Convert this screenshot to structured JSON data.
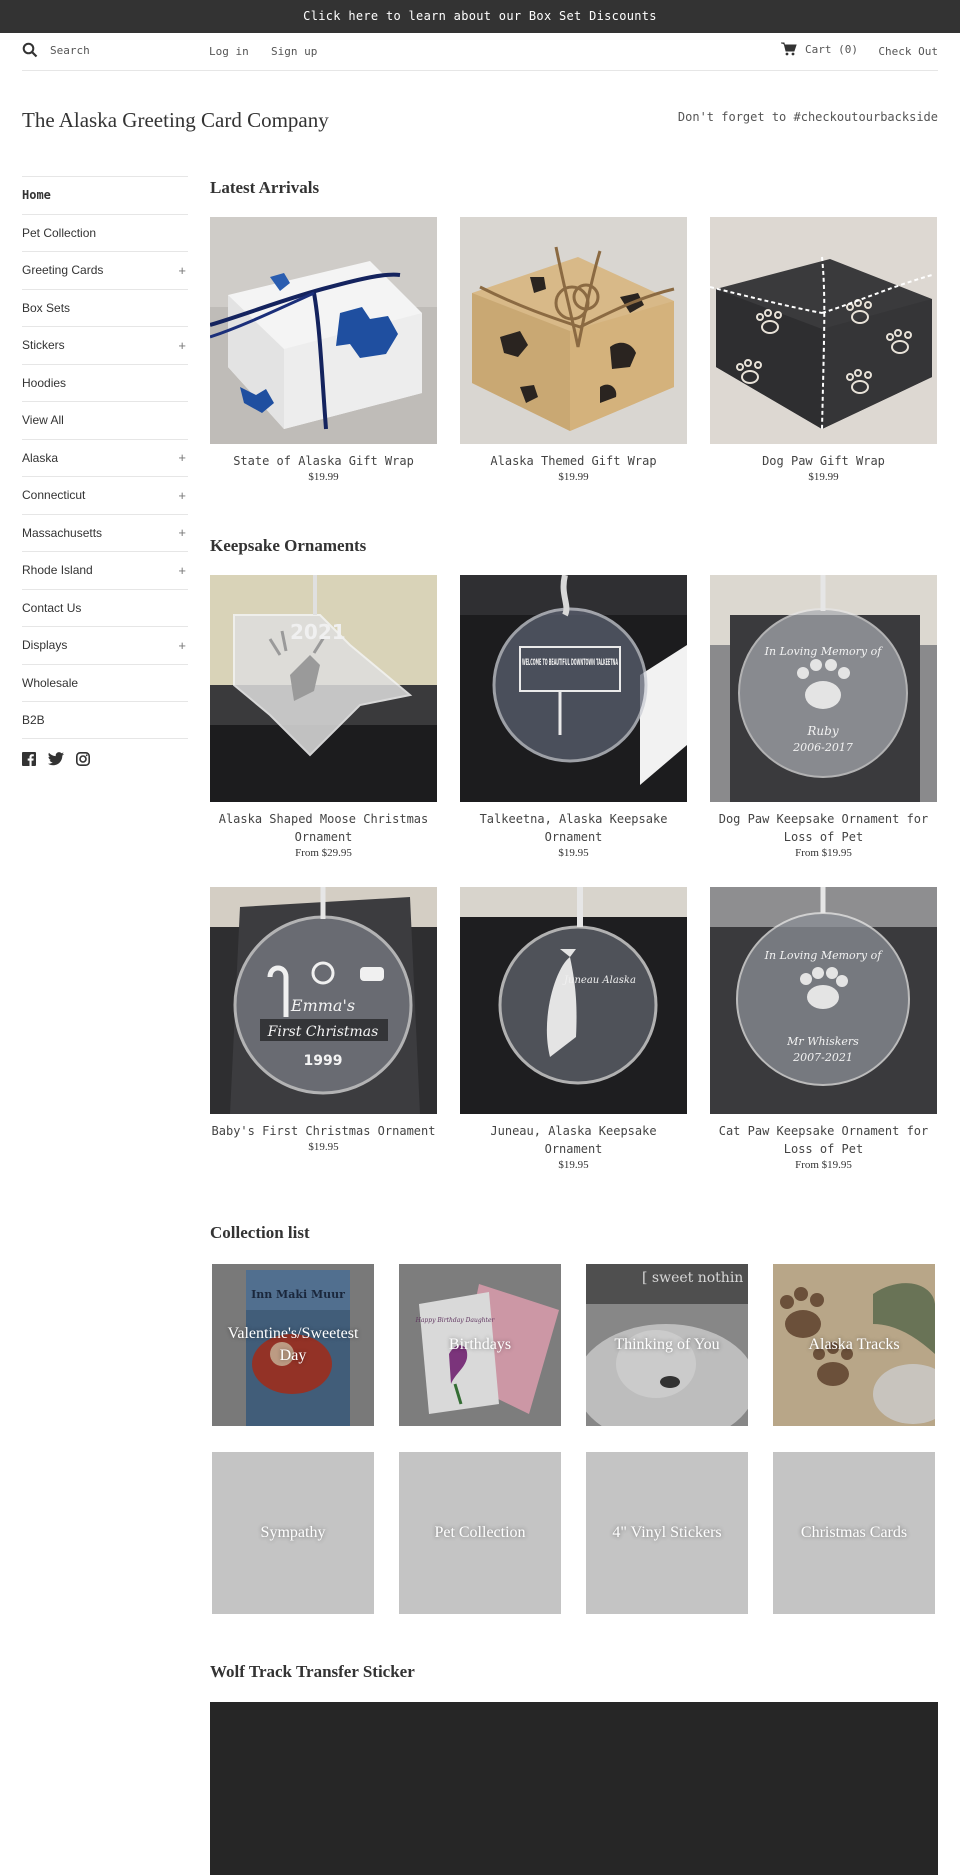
{
  "announcement": "Click here to learn about our Box Set Discounts",
  "header": {
    "search_placeholder": "Search",
    "login": "Log in",
    "signup": "Sign up",
    "cart": "Cart (0)",
    "checkout": "Check Out"
  },
  "brand": {
    "name": "The Alaska Greeting Card Company",
    "tagline": "Don't forget to #checkoutourbackside"
  },
  "sidebar": {
    "items": [
      {
        "label": "Home",
        "expandable": ""
      },
      {
        "label": "Pet Collection",
        "expandable": ""
      },
      {
        "label": "Greeting Cards",
        "expandable": "+"
      },
      {
        "label": "Box Sets",
        "expandable": ""
      },
      {
        "label": "Stickers",
        "expandable": "+"
      },
      {
        "label": "Hoodies",
        "expandable": ""
      },
      {
        "label": "View All",
        "expandable": ""
      },
      {
        "label": "Alaska",
        "expandable": "+"
      },
      {
        "label": "Connecticut",
        "expandable": "+"
      },
      {
        "label": "Massachusetts",
        "expandable": "+"
      },
      {
        "label": "Rhode Island",
        "expandable": "+"
      },
      {
        "label": "Contact Us",
        "expandable": ""
      },
      {
        "label": "Displays",
        "expandable": "+"
      },
      {
        "label": "Wholesale",
        "expandable": ""
      },
      {
        "label": "B2B",
        "expandable": ""
      }
    ],
    "social": [
      "facebook-icon",
      "twitter-icon",
      "instagram-icon"
    ]
  },
  "sections": {
    "latest": {
      "title": "Latest Arrivals",
      "products": [
        {
          "name": "State of Alaska Gift Wrap",
          "price": "$19.99"
        },
        {
          "name": "Alaska Themed Gift Wrap",
          "price": "$19.99"
        },
        {
          "name": "Dog Paw Gift Wrap",
          "price": "$19.99"
        }
      ]
    },
    "keepsake": {
      "title": "Keepsake Ornaments",
      "products": [
        {
          "name": "Alaska Shaped Moose Christmas Ornament",
          "price": "From $29.95"
        },
        {
          "name": "Talkeetna, Alaska Keepsake Ornament",
          "price": "$19.95"
        },
        {
          "name": "Dog Paw Keepsake Ornament for Loss of Pet",
          "price": "From $19.95"
        },
        {
          "name": "Baby's First Christmas Ornament",
          "price": "$19.95"
        },
        {
          "name": "Juneau, Alaska Keepsake Ornament",
          "price": "$19.95"
        },
        {
          "name": "Cat Paw Keepsake Ornament for Loss of Pet",
          "price": "From $19.95"
        }
      ]
    },
    "collections": {
      "title": "Collection list",
      "items": [
        {
          "label": "Valentine's/Sweetest Day"
        },
        {
          "label": "Birthdays"
        },
        {
          "label": "Thinking of You"
        },
        {
          "label": "Alaska Tracks"
        },
        {
          "label": "Sympathy"
        },
        {
          "label": "Pet Collection"
        },
        {
          "label": "4\" Vinyl Stickers"
        },
        {
          "label": "Christmas Cards"
        }
      ],
      "image_text": {
        "valentine": "Inn Maki Muur",
        "birthday": "Happy Birthday Daughter",
        "thinking": "[ sweet nothin"
      }
    },
    "video": {
      "title": "Wolf Track Transfer Sticker"
    }
  },
  "ornament_text": {
    "moose_year": "2021",
    "talkeetna_sign": "WELCOME TO BEAUTIFUL DOWNTOWN TALKEETNA",
    "dog_memory": "In Loving Memory of",
    "dog_name": "Ruby",
    "dog_years": "2006-2017",
    "baby_name": "Emma's",
    "baby_title": "First Christmas",
    "baby_year": "1999",
    "juneau_text": "Juneau Alaska",
    "cat_memory": "In Loving Memory of",
    "cat_name": "Mr Whiskers",
    "cat_years": "2007-2021"
  },
  "colors": {
    "announcement_bg": "#333333",
    "video_bg": "#262626",
    "collection_placeholder": "#c4c4c4"
  }
}
